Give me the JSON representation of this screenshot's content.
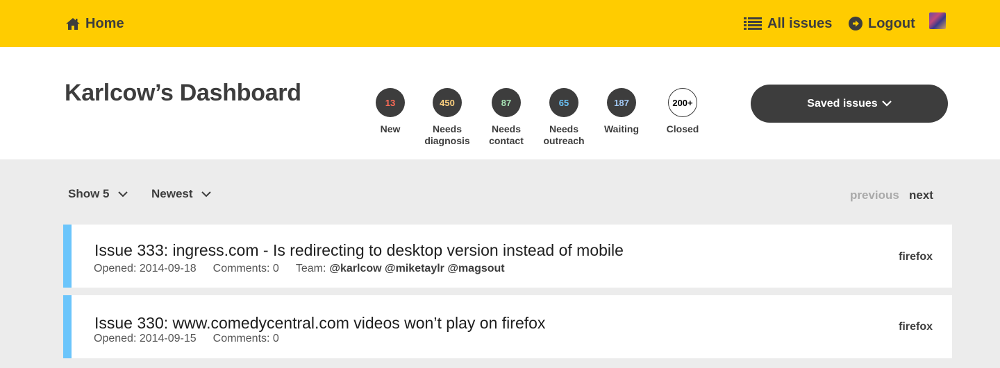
{
  "nav": {
    "home_label": "Home",
    "all_issues_label": "All issues",
    "logout_label": "Logout"
  },
  "header": {
    "title": "Karlcow’s Dashboard",
    "saved_issues_label": "Saved issues"
  },
  "stats": [
    {
      "count": "13",
      "label_line1": "New",
      "label_line2": "",
      "color": "#ff6b57"
    },
    {
      "count": "450",
      "label_line1": "Needs",
      "label_line2": "diagnosis",
      "color": "#ffd27f"
    },
    {
      "count": "87",
      "label_line1": "Needs",
      "label_line2": "contact",
      "color": "#a7e3b5"
    },
    {
      "count": "65",
      "label_line1": "Needs",
      "label_line2": "outreach",
      "color": "#6bc5fb"
    },
    {
      "count": "187",
      "label_line1": "Waiting",
      "label_line2": "",
      "color": "#a3c9f5"
    },
    {
      "count": "200+",
      "label_line1": "Closed",
      "label_line2": "",
      "color": "#000000"
    }
  ],
  "controls": {
    "show_label": "Show 5",
    "sort_label": "Newest",
    "previous_label": "previous",
    "next_label": "next"
  },
  "issues": [
    {
      "title": "Issue 333: ingress.com - Is redirecting to desktop version instead of mobile",
      "opened": "Opened: 2014-09-18",
      "comments": "Comments: 0",
      "team_label": "Team:",
      "team": "@karlcow @miketaylr @magsout",
      "browser": "firefox"
    },
    {
      "title": "Issue 330: www.comedycentral.com videos won’t play on firefox",
      "opened": "Opened: 2014-09-15",
      "comments": "Comments: 0",
      "browser": "firefox"
    }
  ],
  "colors": {
    "accent": "#ffcc00",
    "issue_border": "#6bc5fb",
    "dark": "#3d3d3d"
  }
}
